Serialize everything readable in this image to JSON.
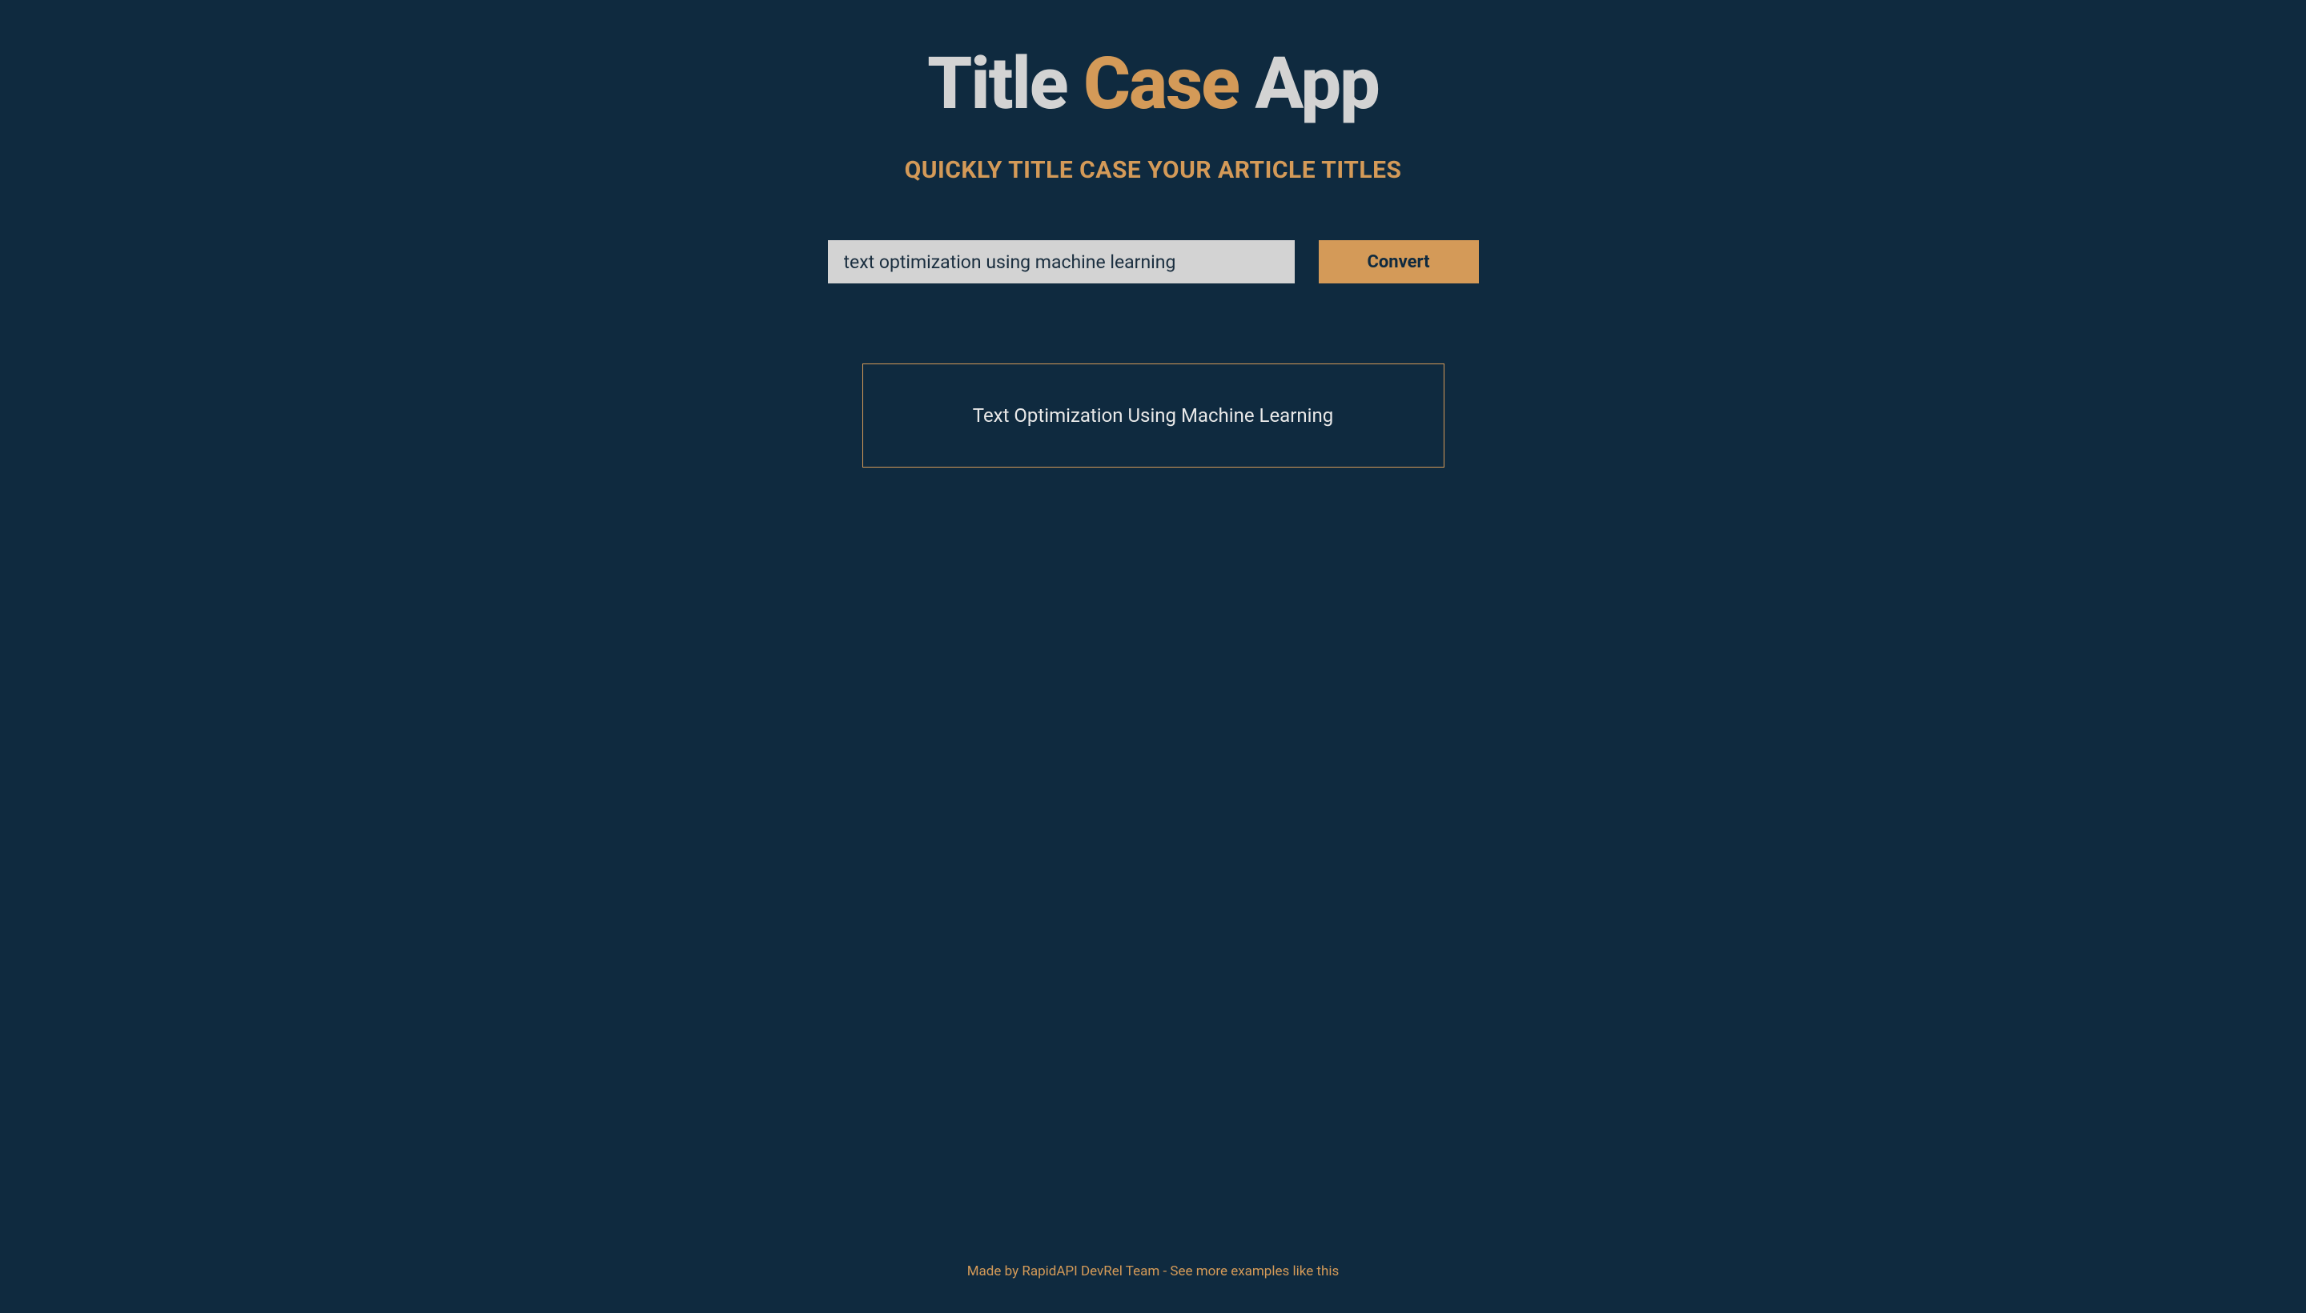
{
  "header": {
    "title_part1": "Title ",
    "title_accent": "Case",
    "title_part2": " App",
    "subtitle": "QUICKLY TITLE CASE YOUR ARTICLE TITLES"
  },
  "input": {
    "value": "text optimization using machine learning",
    "button_label": "Convert"
  },
  "result": {
    "text": "Text Optimization Using Machine Learning"
  },
  "footer": {
    "text": "Made by RapidAPI DevRel Team - See more examples like this"
  }
}
